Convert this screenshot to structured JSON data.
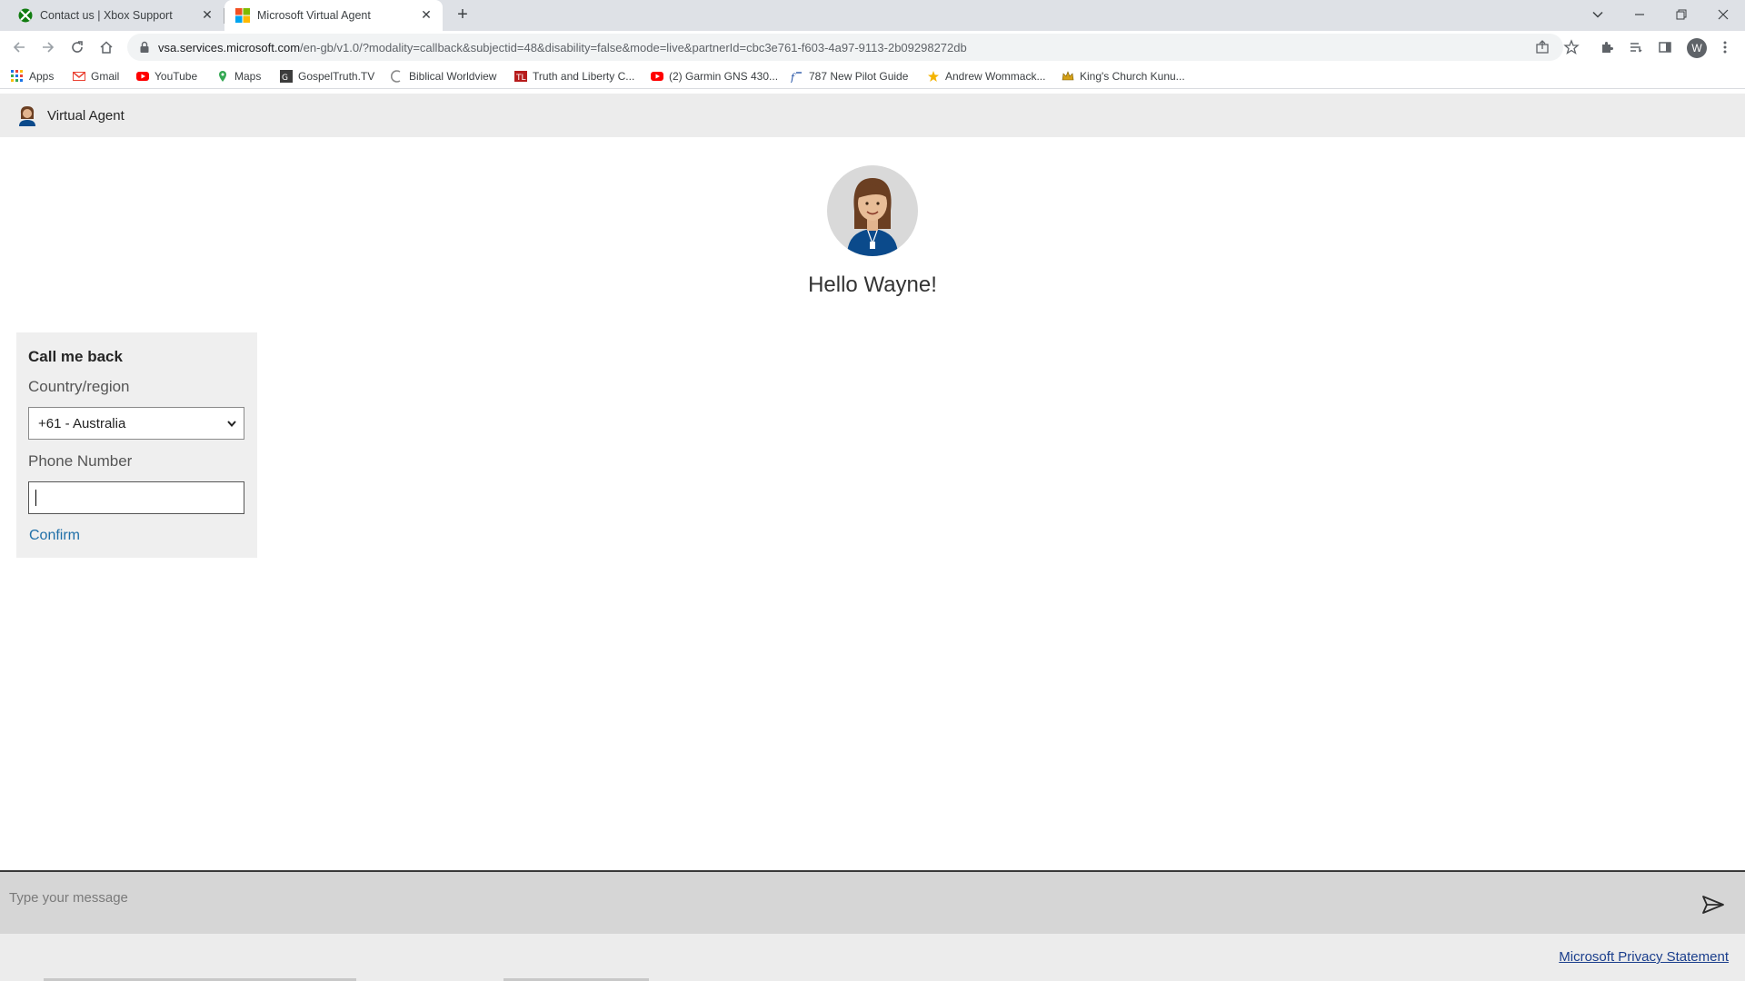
{
  "browser": {
    "tabs": [
      {
        "title": "Contact us | Xbox Support",
        "icon": "xbox-icon",
        "active": false
      },
      {
        "title": "Microsoft Virtual Agent",
        "icon": "microsoft-icon",
        "active": true
      }
    ],
    "address": {
      "domain": "vsa.services.microsoft.com",
      "path": "/en-gb/v1.0/?modality=callback&subjectid=48&disability=false&mode=live&partnerId=cbc3e761-f603-4a97-9113-2b09298272db"
    },
    "profile_initial": "W",
    "bookmarks": [
      {
        "label": "Apps",
        "icon": "apps-grid-icon"
      },
      {
        "label": "Gmail",
        "icon": "gmail-icon"
      },
      {
        "label": "YouTube",
        "icon": "youtube-icon"
      },
      {
        "label": "Maps",
        "icon": "maps-icon"
      },
      {
        "label": "GospelTruth.TV",
        "icon": "gospeltruth-icon"
      },
      {
        "label": "Biblical Worldview",
        "icon": "biblical-worldview-icon"
      },
      {
        "label": "Truth and Liberty C...",
        "icon": "truth-liberty-icon"
      },
      {
        "label": "(2) Garmin GNS 430...",
        "icon": "youtube-icon"
      },
      {
        "label": "787 New Pilot Guide",
        "icon": "pilot-guide-icon"
      },
      {
        "label": "Andrew Wommack...",
        "icon": "star-icon"
      },
      {
        "label": "King's Church Kunu...",
        "icon": "crown-icon"
      }
    ]
  },
  "page": {
    "header_title": "Virtual Agent",
    "greeting": "Hello Wayne!",
    "callback_card": {
      "title": "Call me back",
      "country_label": "Country/region",
      "country_value": "+61 - Australia",
      "phone_label": "Phone Number",
      "phone_value": "",
      "confirm_label": "Confirm"
    },
    "composer": {
      "placeholder": "Type your message"
    },
    "footer": {
      "privacy_link": "Microsoft Privacy Statement"
    }
  },
  "colors": {
    "link": "#1f6fa8",
    "header_bg": "#ececec",
    "agent_shirt": "#0b4a8b"
  }
}
